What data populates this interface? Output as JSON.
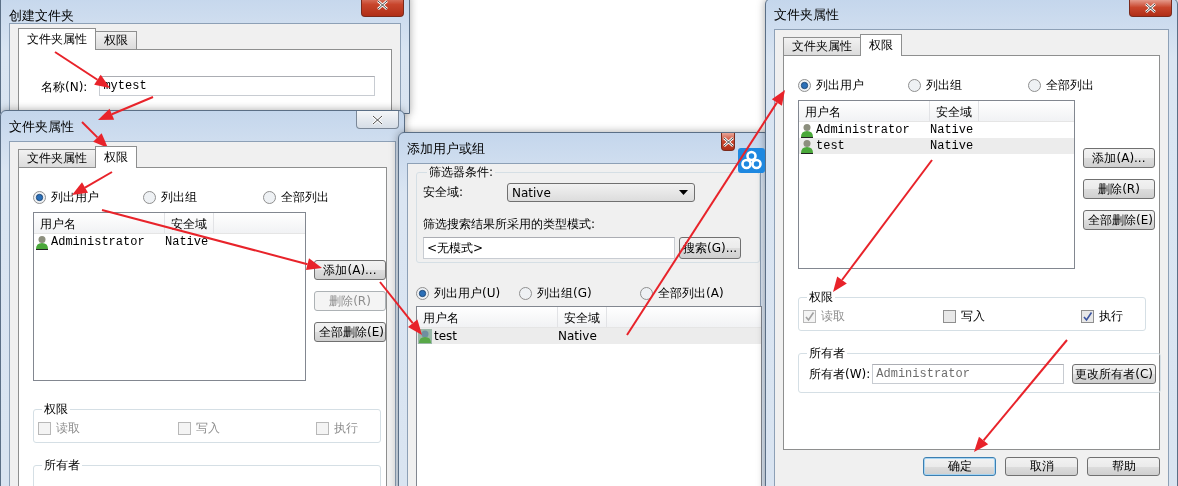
{
  "windows": [
    {
      "kind": "create",
      "title": "创建文件夹",
      "active": true,
      "tabs": [
        {
          "label": "文件夹属性",
          "selected": true
        },
        {
          "label": "权限",
          "selected": false
        }
      ],
      "name_label": "名称(N):",
      "name_value": "mytest"
    },
    {
      "kind": "properties",
      "title": "文件夹属性",
      "active": false,
      "tabs": [
        {
          "label": "文件夹属性",
          "selected": false
        },
        {
          "label": "权限",
          "selected": true
        }
      ],
      "radios": [
        {
          "label": "列出用户",
          "selected": true
        },
        {
          "label": "列出组",
          "selected": false
        },
        {
          "label": "全部列出",
          "selected": false
        }
      ],
      "columns": [
        "用户名",
        "安全域"
      ],
      "rows": [
        {
          "user": "Administrator",
          "domain": "Native",
          "selected": false
        }
      ],
      "buttons": [
        {
          "label": "添加(A)...",
          "disabled": false
        },
        {
          "label": "删除(R)",
          "disabled": true
        },
        {
          "label": "全部删除(E)",
          "disabled": false
        }
      ],
      "permissions_title": "权限",
      "permissions": [
        {
          "label": "读取",
          "checked": false,
          "disabled": true
        },
        {
          "label": "写入",
          "checked": false,
          "disabled": true
        },
        {
          "label": "执行",
          "checked": false,
          "disabled": true
        }
      ],
      "owner_title": "所有者"
    },
    {
      "kind": "add",
      "title": "添加用户或组",
      "active": true,
      "filter_title": "筛选器条件:",
      "domain_label": "安全域:",
      "domain_value": "Native",
      "pattern_label": "筛选搜索结果所采用的类型模式:",
      "pattern_value": "<无模式>",
      "search_button": "搜索(G)...",
      "radios": [
        {
          "label": "列出用户(U)",
          "selected": true
        },
        {
          "label": "列出组(G)",
          "selected": false
        },
        {
          "label": "全部列出(A)",
          "selected": false
        }
      ],
      "columns": [
        "用户名",
        "安全域"
      ],
      "rows": [
        {
          "user": "test",
          "domain": "Native",
          "selected": true
        }
      ]
    },
    {
      "kind": "properties",
      "title": "文件夹属性",
      "active": true,
      "tabs": [
        {
          "label": "文件夹属性",
          "selected": false
        },
        {
          "label": "权限",
          "selected": true
        }
      ],
      "radios": [
        {
          "label": "列出用户",
          "selected": true
        },
        {
          "label": "列出组",
          "selected": false
        },
        {
          "label": "全部列出",
          "selected": false
        }
      ],
      "columns": [
        "用户名",
        "安全域"
      ],
      "rows": [
        {
          "user": "Administrator",
          "domain": "Native",
          "selected": false
        },
        {
          "user": "test",
          "domain": "Native",
          "selected": true
        }
      ],
      "buttons": [
        {
          "label": "添加(A)...",
          "disabled": false
        },
        {
          "label": "删除(R)",
          "disabled": false
        },
        {
          "label": "全部删除(E)",
          "disabled": false
        }
      ],
      "permissions_title": "权限",
      "permissions": [
        {
          "label": "读取",
          "checked": true,
          "disabled": true
        },
        {
          "label": "写入",
          "checked": false,
          "disabled": false
        },
        {
          "label": "执行",
          "checked": true,
          "disabled": false
        }
      ],
      "owner_title": "所有者",
      "owner_label": "所有者(W):",
      "owner_value": "Administrator",
      "change_button": "更改所有者(C)",
      "footer_buttons": [
        {
          "label": "确定",
          "default": true
        },
        {
          "label": "取消",
          "default": false
        },
        {
          "label": "帮助",
          "default": false
        }
      ]
    }
  ]
}
